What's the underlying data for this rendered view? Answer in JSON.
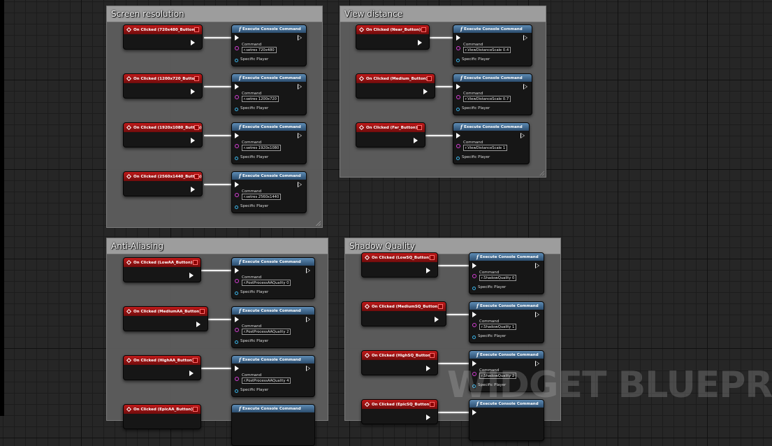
{
  "editor": {
    "watermark": "WIDGET BLUEPRINT",
    "node_title": "Execute Console Command",
    "command_label": "Command",
    "specific_player_label": "Specific Player"
  },
  "colors": {
    "event_node": "#b01616",
    "function_node": "#4a7aa6",
    "command_pin": "#d43ed4",
    "player_pin": "#3ab4e8",
    "comment_box": "#5f5f5f"
  },
  "icons": {
    "event": "event-diamond-icon",
    "function": "function-f-icon",
    "exec": "exec-arrow-icon"
  },
  "groups": [
    {
      "title": "Screen resolution",
      "rows": [
        {
          "event": "On Clicked (720x480_Button)",
          "command": "r.setres 720x480"
        },
        {
          "event": "On Clicked (1200x720_Button)",
          "command": "r.setres 1200x720"
        },
        {
          "event": "On Clicked (1920x1080_Button)",
          "command": "r.setres 1920x1080"
        },
        {
          "event": "On Clicked (2560x1440_Button)",
          "command": "r.setres 2560x1440"
        }
      ]
    },
    {
      "title": "View distance",
      "rows": [
        {
          "event": "On Clicked (Near_Button)",
          "command": "r.ViewDistanceScale 0.4"
        },
        {
          "event": "On Clicked (Medium_Button)",
          "command": "r.ViewDistanceScale 0.7"
        },
        {
          "event": "On Clicked (Far_Button)",
          "command": "r.ViewDistanceScale 1"
        }
      ]
    },
    {
      "title": "Anti-Aliasing",
      "rows": [
        {
          "event": "On Clicked (LowAA_Button)",
          "command": "r.PostProcessAAQuality 0"
        },
        {
          "event": "On Clicked (MediumAA_Button)",
          "command": "r.PostProcessAAQuality 2"
        },
        {
          "event": "On Clicked (HighAA_Button)",
          "command": "r.PostProcessAAQuality 4"
        },
        {
          "event": "On Clicked (EpicAA_Button)",
          "command": ""
        }
      ]
    },
    {
      "title": "Shadow Quality",
      "rows": [
        {
          "event": "On Clicked (LowSQ_Button)",
          "command": "r.ShadowQuality 0"
        },
        {
          "event": "On Clicked (MediumSQ_Button)",
          "command": "r.ShadowQuality 1"
        },
        {
          "event": "On Clicked (HighSQ_Button)",
          "command": "r.ShadowQuality 2"
        },
        {
          "event": "On Clicked (EpicSQ_Button)",
          "command": ""
        }
      ]
    }
  ]
}
